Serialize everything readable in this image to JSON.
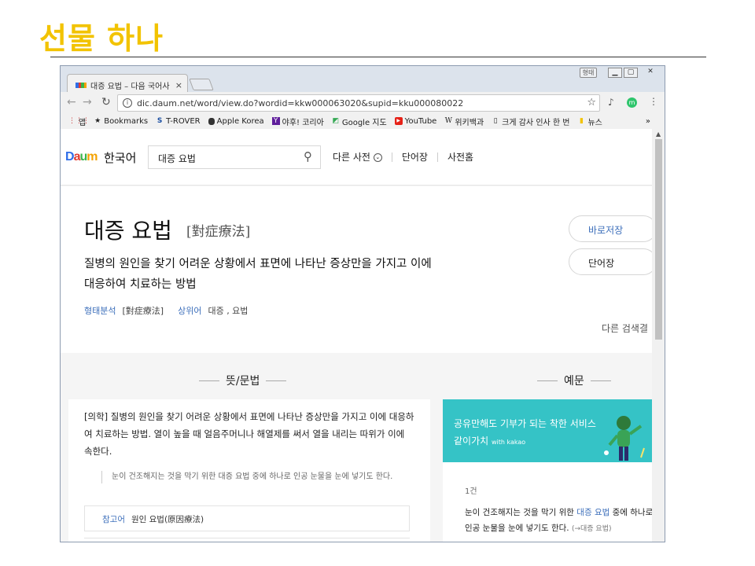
{
  "slide": {
    "title": "선물 하나"
  },
  "browser": {
    "tab_title": "대증 요법 – 다음 국어사",
    "tab_close": "×",
    "win_user": "형태",
    "url": "dic.daum.net/word/view.do?wordid=kkw000063020&supid=kku000080022",
    "bookmarks": [
      {
        "icon": "⋮⋮⋮",
        "label": "앱"
      },
      {
        "icon": "★",
        "label": "Bookmarks"
      },
      {
        "icon": "S",
        "label": "T-ROVER"
      },
      {
        "icon": "",
        "label": "Apple Korea"
      },
      {
        "icon": "Y",
        "label": "야후! 코리아"
      },
      {
        "icon": "◩",
        "label": "Google 지도"
      },
      {
        "icon": "▶",
        "label": "YouTube"
      },
      {
        "icon": "W",
        "label": "위키백과"
      },
      {
        "icon": "▯",
        "label": "크게 감사 인사 한 번"
      },
      {
        "icon": "▮",
        "label": "뉴스"
      }
    ],
    "more_bookmarks": "»"
  },
  "site": {
    "logo": {
      "d": "D",
      "a": "a",
      "u": "u",
      "m": "m"
    },
    "name": "한국어",
    "search_value": "대증 요법",
    "nav": [
      "다른 사전",
      "단어장",
      "사전홈"
    ]
  },
  "word": {
    "headword": "대증 요법",
    "hanja": "[對症療法]",
    "meaning": "질병의 원인을 찾기 어려운 상황에서 표면에 나타난 증상만을 가지고 이에 대응하여 치료하는 방법",
    "meta": {
      "morph_label": "형태분석",
      "morph_value": "[對症療法]",
      "hyper_label": "상위어",
      "hyper_value": "대증 , 요법"
    },
    "btn_save": "바로저장",
    "btn_wordbook": "단어장",
    "other_search": "다른 검색결"
  },
  "sections": {
    "left_title": "뜻/문법",
    "right_title": "예문"
  },
  "definition": {
    "text": "[의학] 질병의 원인을 찾기 어려운 상황에서 표면에 나타난 증상만을 가지고 이에 대응하여 치료하는 방법. 열이 높을 때 얼음주머니나 해열제를 써서 열을 내리는 따위가 이에 속한다.",
    "example": "눈이 건조해지는 것을 막기 위한 대증 요법 중에 하나로 인공 눈물을 눈에 넣기도 한다.",
    "ref_label": "참고어",
    "ref_value": "원인 요법(原因療法)"
  },
  "ad": {
    "line1": "공유만해도 기부가 되는 착한 서비스",
    "line2": "같이가치",
    "line2_small": "with kakao"
  },
  "examples": {
    "count": "1건",
    "pre": "눈이 건조해지는 것을 막기 위한 ",
    "highlight": "대증 요법",
    "post": " 중에 하나로 인공 눈물을 눈에 넣기도 한다. ",
    "source": "(→대증 요법)"
  }
}
